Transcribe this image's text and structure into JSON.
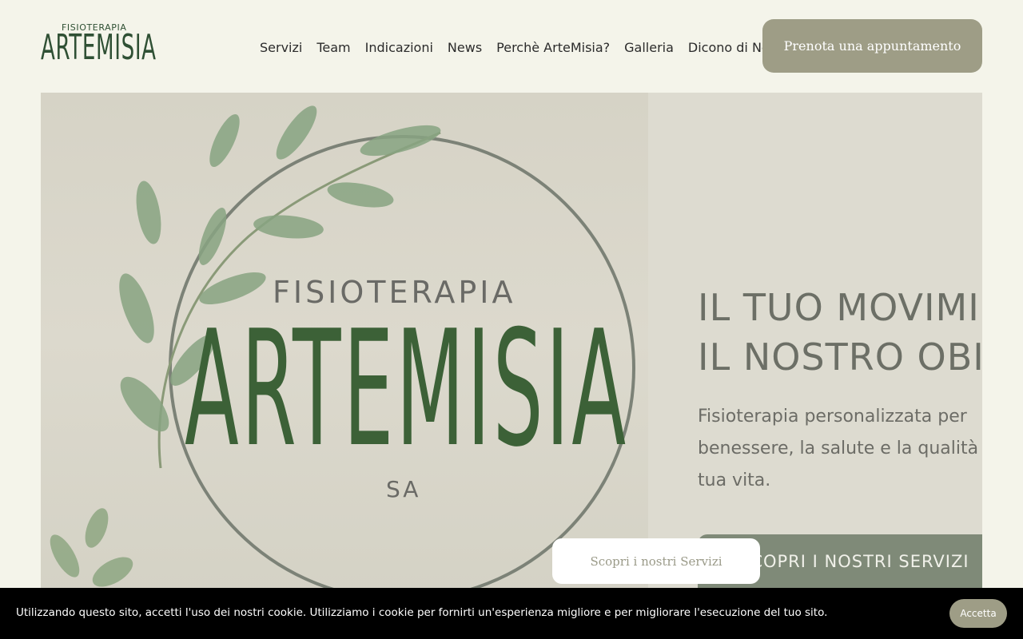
{
  "header": {
    "logo_small": "FISIOTERAPIA",
    "logo_big": "ARTEMISIA",
    "nav": [
      {
        "label": "Servizi"
      },
      {
        "label": "Team"
      },
      {
        "label": "Indicazioni"
      },
      {
        "label": "News"
      },
      {
        "label": "Perchè ArteMisia?"
      },
      {
        "label": "Galleria"
      },
      {
        "label": "Dicono di Noi"
      }
    ],
    "cta_label": "Prenota una appuntamento"
  },
  "hero": {
    "logo_small": "FISIOTERAPIA",
    "logo_big": "ARTEMISIA",
    "logo_sa": "SA",
    "heading_line1": "IL TUO MOVIMI",
    "heading_line2": "IL NOSTRO OBI",
    "text_line1": "Fisioterapia personalizzata per",
    "text_line2": "benessere, la salute e la qualità",
    "text_line3": "tua vita.",
    "button_label": "SCOPRI I NOSTRI SERVIZI"
  },
  "floating_button": {
    "label": "Scopri i nostri Servizi"
  },
  "cookie": {
    "text": "Utilizzando questo sito, accetti l'uso dei nostri cookie. Utilizziamo i cookie per fornirti un'esperienza migliore e per migliorare l'esecuzione del tuo sito.",
    "accept_label": "Accetta"
  },
  "colors": {
    "background": "#f4f4ea",
    "brand_green": "#2f5034",
    "cta": "#9e9d86",
    "hero_button": "#7f8a78"
  }
}
